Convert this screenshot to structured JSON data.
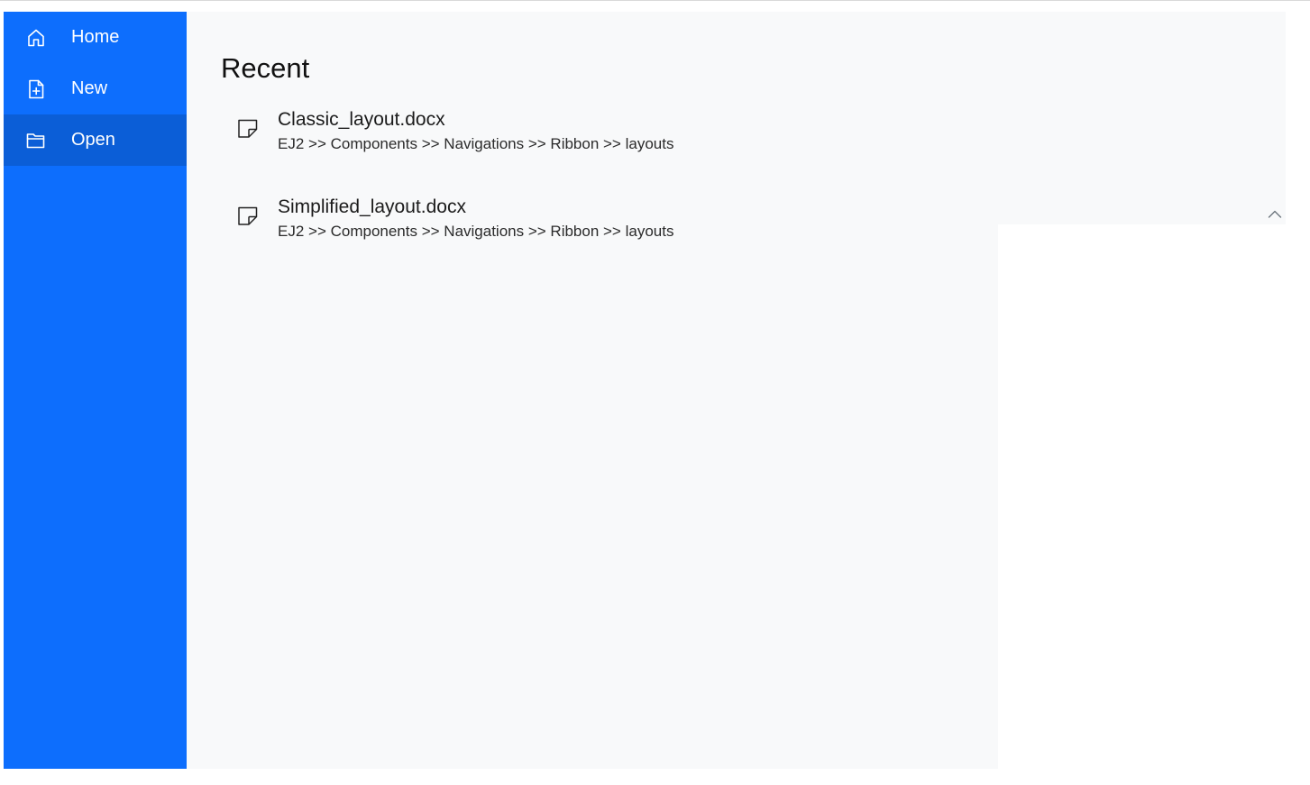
{
  "menu": {
    "items": [
      {
        "label": "Home",
        "icon": "home-icon",
        "selected": false
      },
      {
        "label": "New",
        "icon": "new-file-icon",
        "selected": false
      },
      {
        "label": "Open",
        "icon": "folder-open-icon",
        "selected": true
      }
    ]
  },
  "main": {
    "title": "Recent",
    "recent_files": [
      {
        "name": "Classic_layout.docx",
        "path": "EJ2 >> Components >> Navigations >> Ribbon >> layouts",
        "icon": "document-icon"
      },
      {
        "name": "Simplified_layout.docx",
        "path": "EJ2 >> Components >> Navigations >> Ribbon >> layouts",
        "icon": "document-icon"
      }
    ]
  },
  "collapse": {
    "icon": "chevron-up-icon"
  },
  "colors": {
    "sidebar": "#0d6efd",
    "sidebar_selected": "#0b5ed7",
    "content_bg": "#f8f9fa"
  }
}
